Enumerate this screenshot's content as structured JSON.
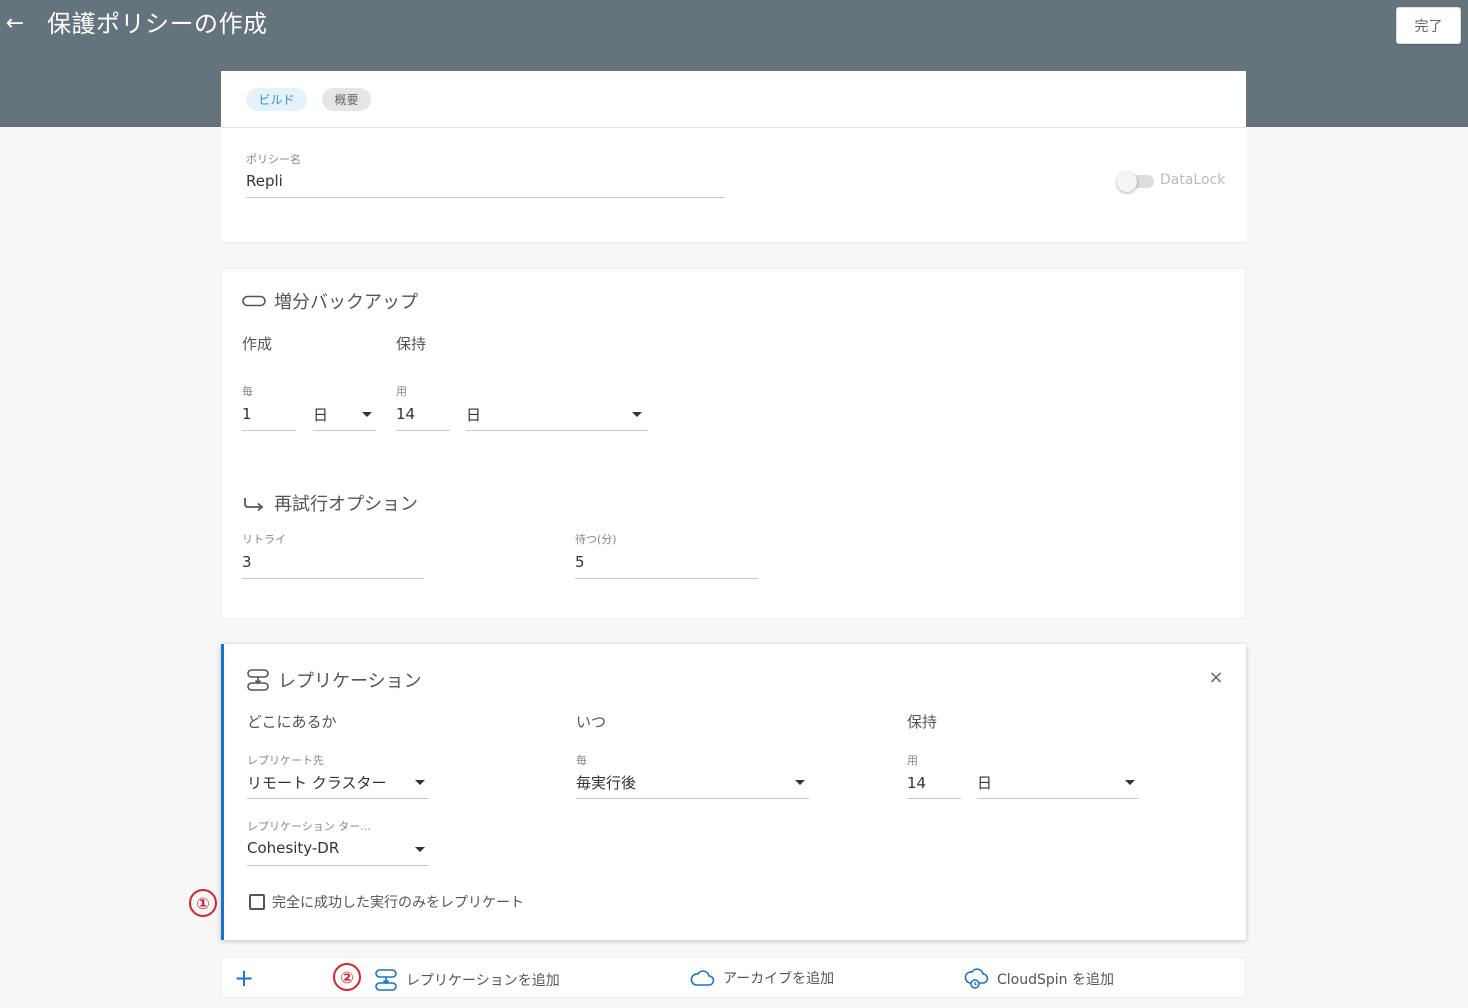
{
  "header": {
    "title": "保護ポリシーの作成",
    "done_label": "完了"
  },
  "steps": {
    "build": "ビルド",
    "summary": "概要"
  },
  "policy": {
    "name_label": "ポリシー名",
    "name_value": "Repli",
    "datalock_label": "DataLock",
    "datalock_on": false
  },
  "incremental": {
    "title": "増分バックアップ",
    "create_head": "作成",
    "retain_head": "保持",
    "every_label": "毎",
    "every_value": "1",
    "every_unit": "日",
    "for_label": "用",
    "for_value": "14",
    "for_unit": "日"
  },
  "retry": {
    "title": "再試行オプション",
    "retries_label": "リトライ",
    "retries_value": "3",
    "wait_label": "待つ(分)",
    "wait_value": "5"
  },
  "replication": {
    "title": "レプリケーション",
    "where_head": "どこにあるか",
    "when_head": "いつ",
    "retain_head": "保持",
    "target_label": "レプリケート先",
    "target_value": "リモート クラスター",
    "schedule_label": "毎",
    "schedule_value": "毎実行後",
    "retain_label": "用",
    "retain_value": "14",
    "retain_unit": "日",
    "cluster_label": "レプリケーション ター...",
    "cluster_value": "Cohesity-DR",
    "checkbox_label": "完全に成功した実行のみをレプリケート",
    "checkbox_checked": false
  },
  "add_bar": {
    "add_replication": "レプリケーションを追加",
    "add_archive": "アーカイブを追加",
    "add_cloudspin": "CloudSpin を追加"
  },
  "markers": {
    "one": "①",
    "two": "②"
  },
  "colors": {
    "header_bg": "#65737c",
    "accent": "#1a73c9",
    "marker": "#d9232e"
  }
}
